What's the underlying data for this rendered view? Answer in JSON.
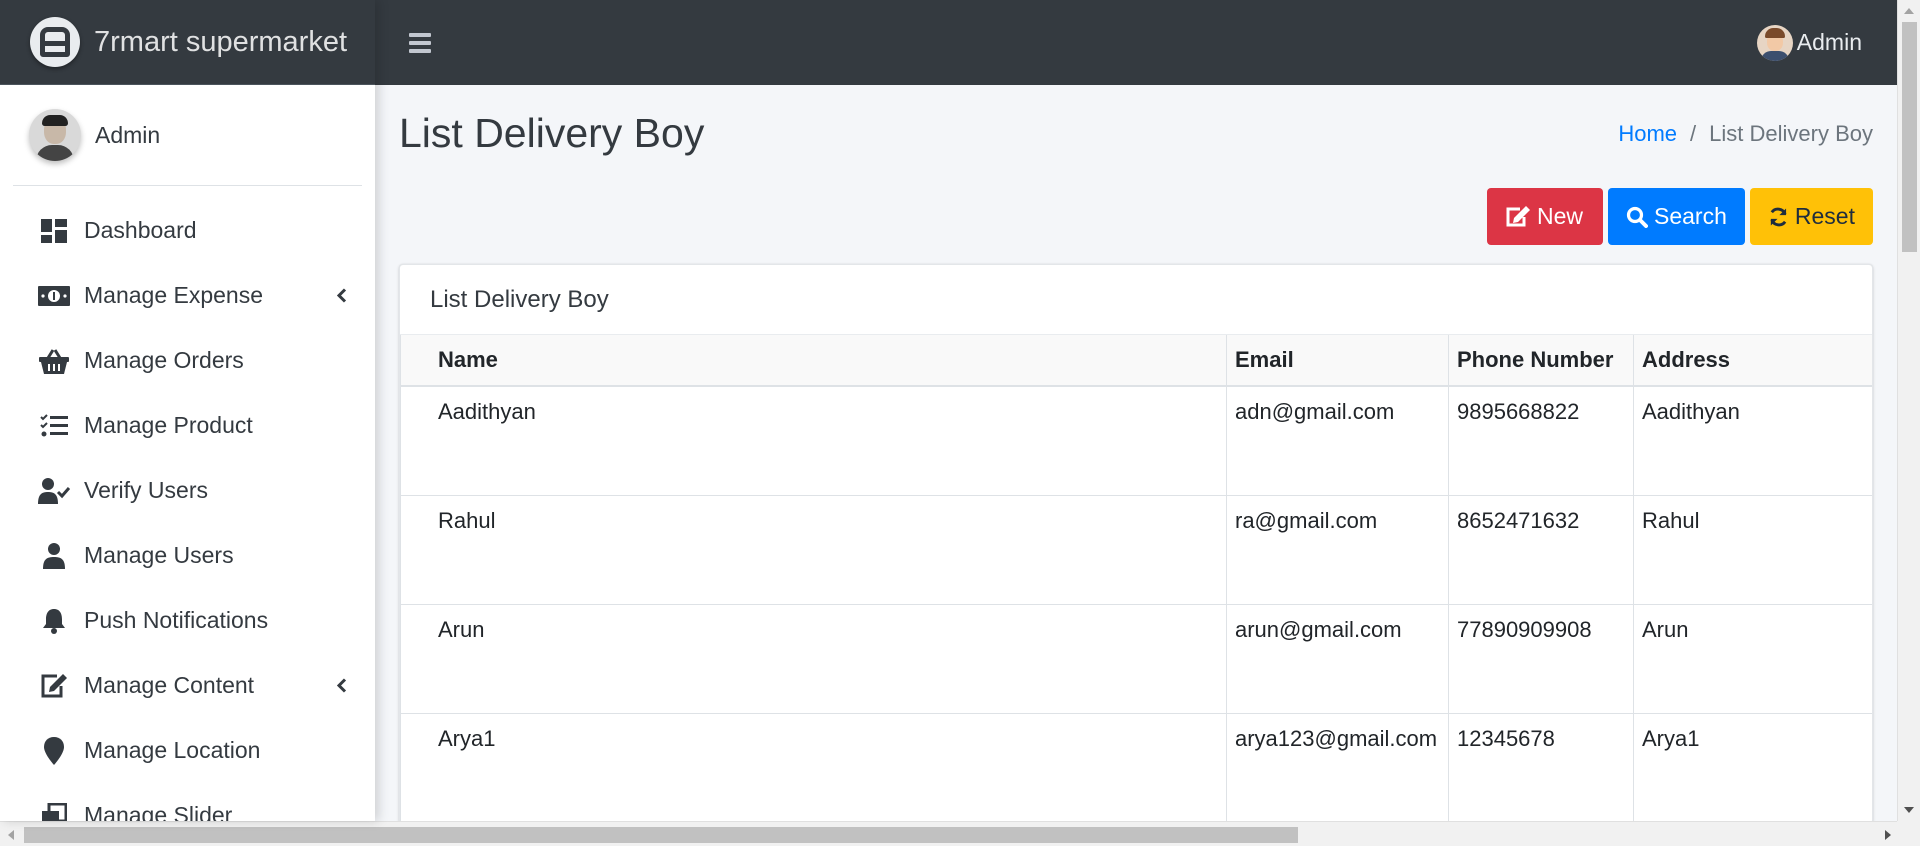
{
  "brand": {
    "name": "7rmart supermarket"
  },
  "sidebar": {
    "user_name": "Admin",
    "items": [
      {
        "label": "Dashboard",
        "icon": "dashboard-icon",
        "has_arrow": false
      },
      {
        "label": "Manage Expense",
        "icon": "money-bill-icon",
        "has_arrow": true
      },
      {
        "label": "Manage Orders",
        "icon": "basket-icon",
        "has_arrow": false
      },
      {
        "label": "Manage Product",
        "icon": "tasks-list-icon",
        "has_arrow": false
      },
      {
        "label": "Verify Users",
        "icon": "user-check-icon",
        "has_arrow": false
      },
      {
        "label": "Manage Users",
        "icon": "user-icon",
        "has_arrow": false
      },
      {
        "label": "Push Notifications",
        "icon": "bell-icon",
        "has_arrow": false
      },
      {
        "label": "Manage Content",
        "icon": "edit-icon",
        "has_arrow": true
      },
      {
        "label": "Manage Location",
        "icon": "map-marker-icon",
        "has_arrow": false
      },
      {
        "label": "Manage Slider",
        "icon": "clone-icon",
        "has_arrow": false
      }
    ]
  },
  "topbar": {
    "user_name": "Admin"
  },
  "header": {
    "title": "List Delivery Boy",
    "breadcrumb": {
      "home": "Home",
      "separator": "/",
      "current": "List Delivery Boy"
    }
  },
  "actions": {
    "new_label": "New",
    "search_label": "Search",
    "reset_label": "Reset"
  },
  "card": {
    "title": "List Delivery Boy",
    "columns": [
      "Name",
      "Email",
      "Phone Number",
      "Address"
    ],
    "rows": [
      [
        "Aadithyan",
        "adn@gmail.com",
        "9895668822",
        "Aadithyan"
      ],
      [
        "Rahul",
        "ra@gmail.com",
        "8652471632",
        "Rahul"
      ],
      [
        "Arun",
        "arun@gmail.com",
        "77890909908",
        "Arun"
      ],
      [
        "Arya1",
        "arya123@gmail.com",
        "12345678",
        "Arya1"
      ]
    ]
  },
  "colors": {
    "navbar": "#343a40",
    "danger": "#dc3545",
    "primary": "#007bff",
    "warning": "#ffc107",
    "link": "#007bff"
  }
}
